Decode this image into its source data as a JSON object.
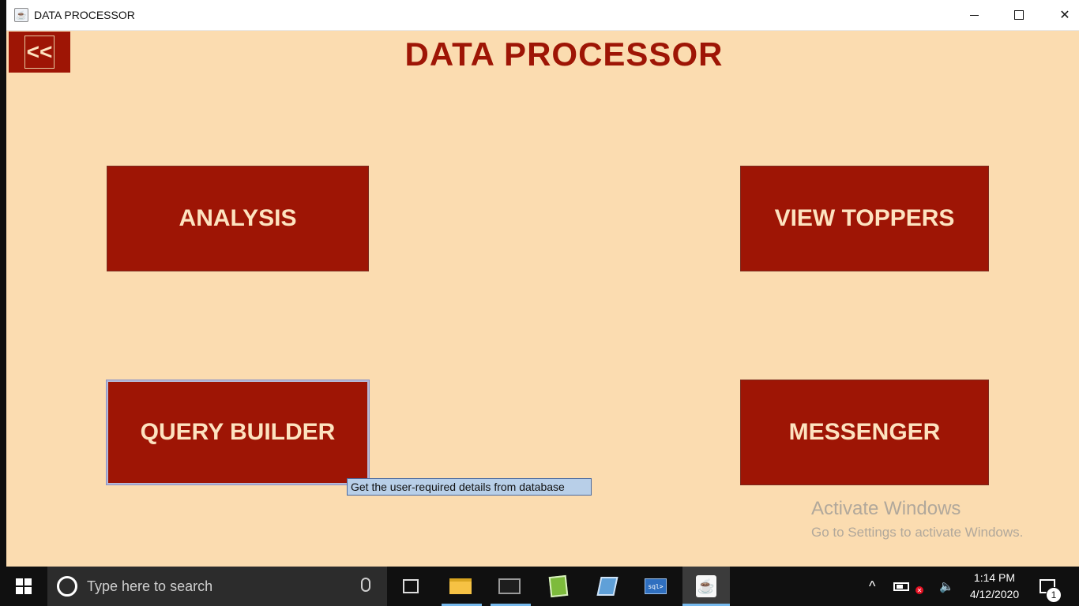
{
  "window": {
    "title": "DATA PROCESSOR",
    "controls": {
      "minimize_icon": "minimize-icon",
      "maximize_icon": "maximize-icon",
      "close_icon": "close-icon",
      "close_glyph": "✕"
    }
  },
  "app": {
    "back_label": "<<",
    "title": "DATA PROCESSOR",
    "accent_color": "#9e1505",
    "background_color": "#fbdcb0",
    "buttons": [
      {
        "label": "ANALYSIS"
      },
      {
        "label": "VIEW TOPPERS"
      },
      {
        "label": "QUERY BUILDER"
      },
      {
        "label": "MESSENGER"
      }
    ],
    "tooltip": "Get the user-required details from database"
  },
  "watermark": {
    "line1": "Activate Windows",
    "line2": "Go to Settings to activate Windows."
  },
  "taskbar": {
    "search_placeholder": "Type here to search",
    "pinned": [
      "file-explorer-icon",
      "command-prompt-icon",
      "notepad-plus-icon",
      "blue-notepad-icon",
      "sql-icon",
      "java-icon"
    ],
    "sql_label": "sql>",
    "clock_time": "1:14 PM",
    "clock_date": "4/12/2020",
    "notification_count": "1",
    "chevron_glyph": "^",
    "speaker_glyph": "🔈"
  }
}
